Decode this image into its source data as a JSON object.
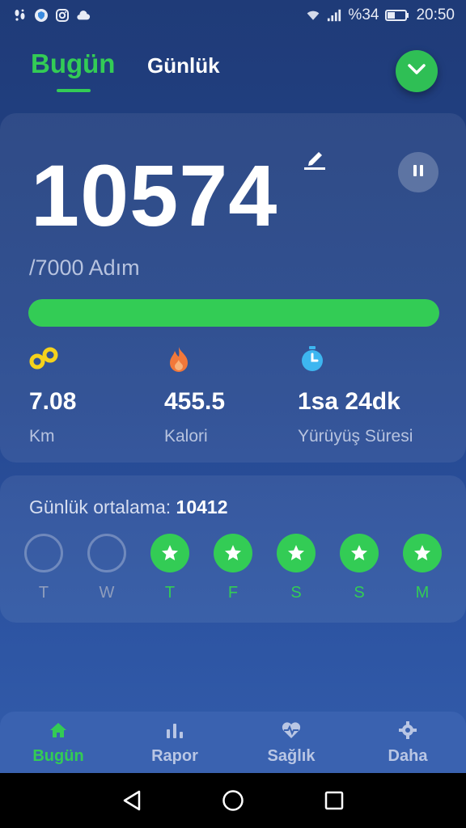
{
  "status_bar": {
    "icons_left": [
      "footprint-icon",
      "shield-icon",
      "instagram-icon",
      "cloud-icon"
    ],
    "wifi": "wifi-icon",
    "signal": "signal-icon",
    "battery_percent": "%34",
    "battery": "battery-icon",
    "time": "20:50"
  },
  "header": {
    "tab_today": "Bugün",
    "tab_daily": "Günlük",
    "dropdown_icon": "chevron-down-icon"
  },
  "summary": {
    "steps": "10574",
    "goal": "/7000 Adım",
    "progress_percent": 100,
    "edit_icon": "pencil-icon",
    "pause_icon": "pause-icon",
    "stats": [
      {
        "icon": "distance-icon",
        "value": "7.08",
        "label": "Km"
      },
      {
        "icon": "flame-icon",
        "value": "455.5",
        "label": "Kalori"
      },
      {
        "icon": "stopwatch-icon",
        "value": "1sa 24dk",
        "label": "Yürüyüş Süresi"
      }
    ]
  },
  "weekly": {
    "avg_label": "Günlük ortalama:",
    "avg_value": "10412",
    "days": [
      {
        "label": "T",
        "achieved": false
      },
      {
        "label": "W",
        "achieved": false
      },
      {
        "label": "T",
        "achieved": true
      },
      {
        "label": "F",
        "achieved": true
      },
      {
        "label": "S",
        "achieved": true
      },
      {
        "label": "S",
        "achieved": true
      },
      {
        "label": "M",
        "achieved": true
      }
    ]
  },
  "bottom_nav": [
    {
      "label": "Bugün",
      "icon": "home-icon",
      "active": true
    },
    {
      "label": "Rapor",
      "icon": "bar-chart-icon",
      "active": false
    },
    {
      "label": "Sağlık",
      "icon": "heart-pulse-icon",
      "active": false
    },
    {
      "label": "Daha",
      "icon": "gear-icon",
      "active": false
    }
  ],
  "colors": {
    "accent_green": "#33cc55",
    "background": "#23448a",
    "nav_bar": "#3a62b0"
  }
}
